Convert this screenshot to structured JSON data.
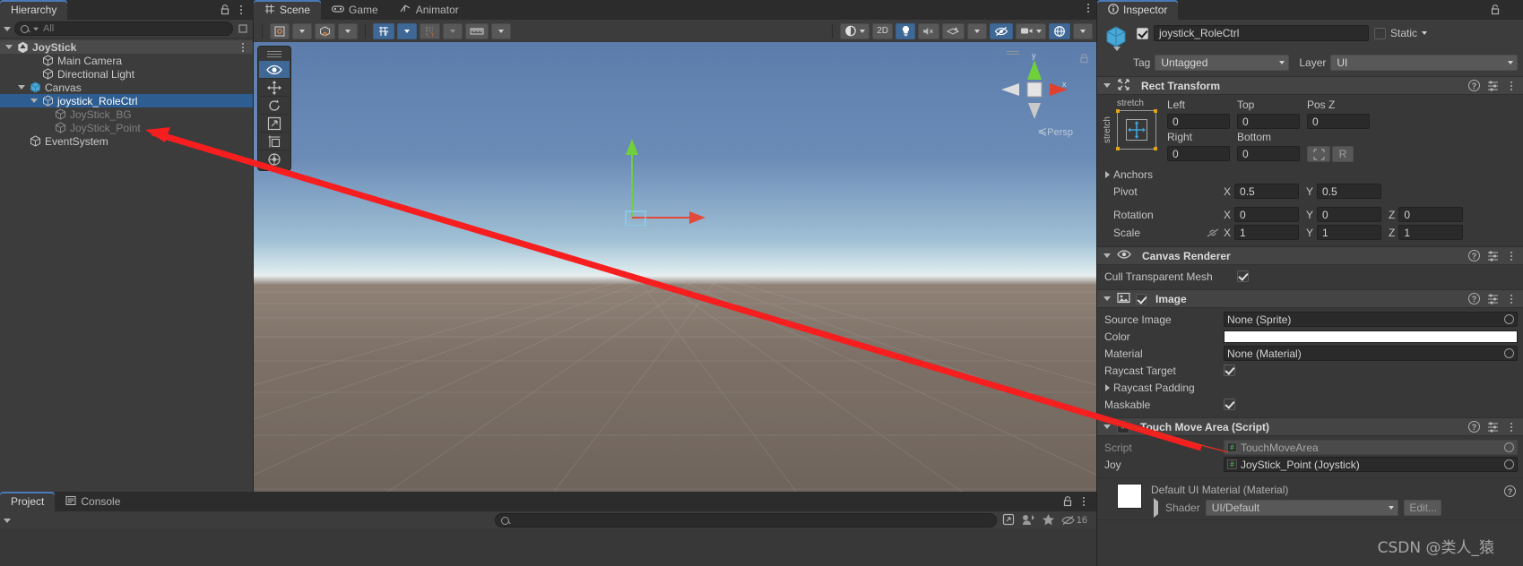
{
  "hierarchy": {
    "tab_label": "Hierarchy",
    "search_placeholder": "All",
    "nodes": [
      {
        "label": "JoyStick",
        "depth": 0,
        "icon": "unity-scene-icon",
        "state": "header",
        "twisty": "open"
      },
      {
        "label": "Main Camera",
        "depth": 2,
        "icon": "gameobject-icon",
        "state": "normal",
        "twisty": "none"
      },
      {
        "label": "Directional Light",
        "depth": 2,
        "icon": "gameobject-icon",
        "state": "normal",
        "twisty": "none"
      },
      {
        "label": "Canvas",
        "depth": 1,
        "icon": "canvas-icon",
        "state": "normal",
        "twisty": "open"
      },
      {
        "label": "joystick_RoleCtrl",
        "depth": 2,
        "icon": "gameobject-icon",
        "state": "selected",
        "twisty": "open"
      },
      {
        "label": "JoyStick_BG",
        "depth": 3,
        "icon": "gameobject-icon",
        "state": "dim",
        "twisty": "none"
      },
      {
        "label": "JoyStick_Point",
        "depth": 3,
        "icon": "gameobject-icon",
        "state": "dim",
        "twisty": "none"
      },
      {
        "label": "EventSystem",
        "depth": 1,
        "icon": "gameobject-icon",
        "state": "normal",
        "twisty": "none"
      }
    ]
  },
  "scene": {
    "tabs": [
      {
        "label": "Scene",
        "icon": "grid-icon",
        "active": true
      },
      {
        "label": "Game",
        "icon": "gamepad-icon",
        "active": false
      },
      {
        "label": "Animator",
        "icon": "animator-icon",
        "active": false
      }
    ],
    "toolbar": {
      "pivot_mode": "center-pivot-icon",
      "handle_space": "global-local-icon",
      "grid_snap": "grid-snap-icon",
      "grid_snap_active": true,
      "snap_increment": "snap-increment-icon",
      "snap_ruler": "ruler-icon",
      "draw_mode": "shaded-icon",
      "two_d_label": "2D",
      "lighting": "light-bulb-icon",
      "lighting_on": true,
      "audio": "audio-mute-icon",
      "fx": "effects-icon",
      "hidden_objects": "visibility-off-icon",
      "hidden_objects_on": true,
      "camera_overlay": "camera-icon",
      "gizmos": "gizmos-icon"
    },
    "tools_overlay": [
      {
        "name": "view-tool",
        "active": true
      },
      {
        "name": "move-tool",
        "active": false
      },
      {
        "name": "rotate-tool",
        "active": false
      },
      {
        "name": "scale-tool",
        "active": false
      },
      {
        "name": "rect-tool",
        "active": false
      },
      {
        "name": "transform-tool",
        "active": false
      }
    ],
    "gizmo": {
      "x_label": "x",
      "y_label": "y",
      "projection_label": "Persp"
    }
  },
  "inspector": {
    "tab_label": "Inspector",
    "object": {
      "name": "joystick_RoleCtrl",
      "enabled": true,
      "static_label": "Static",
      "static_checked": false,
      "tag_label": "Tag",
      "tag_value": "Untagged",
      "layer_label": "Layer",
      "layer_value": "UI"
    },
    "rect_transform": {
      "title": "Rect Transform",
      "anchor_preset_label": "stretch",
      "anchor_preset_side_label": "stretch",
      "fields": [
        {
          "label": "Left",
          "value": "0"
        },
        {
          "label": "Top",
          "value": "0"
        },
        {
          "label": "Pos Z",
          "value": "0"
        },
        {
          "label": "Right",
          "value": "0"
        },
        {
          "label": "Bottom",
          "value": "0"
        }
      ],
      "blueprint_label": "R",
      "anchors_label": "Anchors",
      "pivot_label": "Pivot",
      "pivot": {
        "x": "0.5",
        "y": "0.5"
      },
      "rotation_label": "Rotation",
      "rotation": {
        "x": "0",
        "y": "0",
        "z": "0"
      },
      "scale_label": "Scale",
      "scale": {
        "x": "1",
        "y": "1",
        "z": "1"
      }
    },
    "canvas_renderer": {
      "title": "Canvas Renderer",
      "cull_label": "Cull Transparent Mesh",
      "cull_checked": true
    },
    "image": {
      "title": "Image",
      "enabled": true,
      "source_image_label": "Source Image",
      "source_image_value": "None (Sprite)",
      "color_label": "Color",
      "color_value": "#FFFFFF",
      "material_label": "Material",
      "material_value": "None (Material)",
      "raycast_target_label": "Raycast Target",
      "raycast_target_checked": true,
      "raycast_padding_label": "Raycast Padding",
      "maskable_label": "Maskable",
      "maskable_checked": true
    },
    "touch_move_area": {
      "title": "Touch Move Area (Script)",
      "script_label": "Script",
      "script_value": "TouchMoveArea",
      "joy_label": "Joy",
      "joy_value": "JoyStick_Point (Joystick)"
    },
    "material_preview": {
      "title": "Default UI Material (Material)",
      "shader_label": "Shader",
      "shader_value": "UI/Default",
      "edit_label": "Edit..."
    }
  },
  "project": {
    "tabs": [
      {
        "label": "Project",
        "icon": "folder-icon",
        "active": true
      },
      {
        "label": "Console",
        "icon": "console-icon",
        "active": false
      }
    ],
    "search_placeholder": "",
    "layers_count": "16"
  },
  "watermark": {
    "text": "CSDN @类人_猿"
  },
  "colors": {
    "accent_blue": "#2d5d91",
    "toolbar_active": "#3f6896",
    "panel_bg": "#383838",
    "header_bg": "#444444",
    "annotation_red": "#f61e1e"
  }
}
